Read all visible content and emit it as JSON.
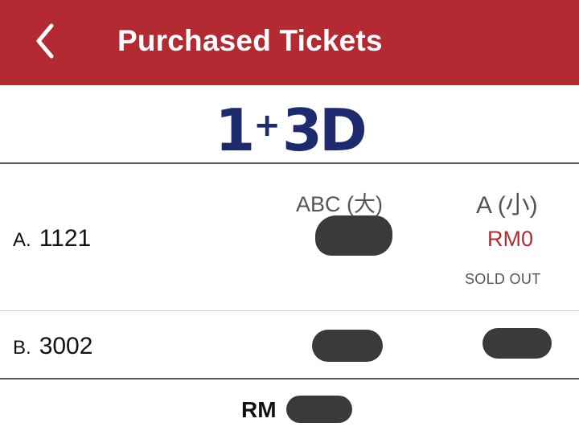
{
  "header": {
    "title": "Purchased Tickets",
    "back_icon": "chevron-left-icon",
    "background_color": "#b32a33"
  },
  "game": {
    "logo_main": "1",
    "logo_plus": "+",
    "logo_rest": "3D",
    "logo_color": "#1d2a6e"
  },
  "columns": {
    "abc": "ABC (大)",
    "a": "A (小)"
  },
  "tickets": [
    {
      "letter": "A.",
      "number": "1121",
      "a_price": "RM0",
      "a_status": "SOLD OUT"
    },
    {
      "letter": "B.",
      "number": "3002"
    }
  ],
  "total": {
    "label": "RM"
  },
  "colors": {
    "price_red": "#b32a33",
    "redaction": "#3a3a3a"
  }
}
